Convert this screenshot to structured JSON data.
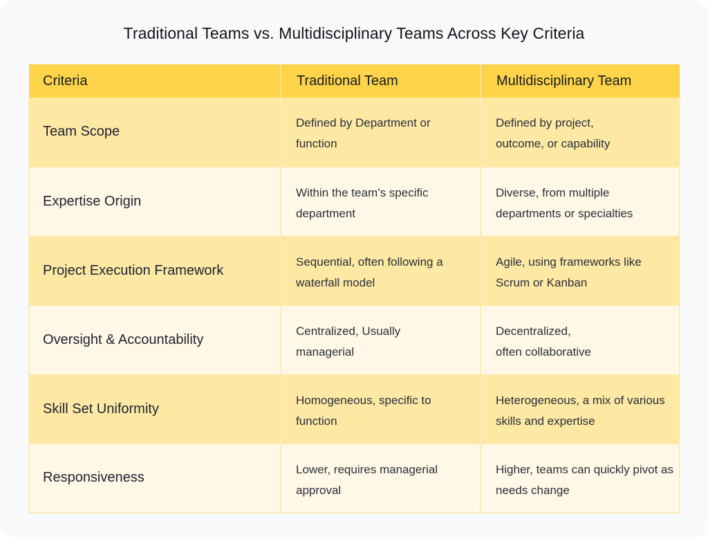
{
  "title": "Traditional Teams vs. Multidisciplinary Teams Across Key Criteria",
  "table": {
    "headers": [
      "Criteria",
      "Traditional Team",
      "Multidisciplinary Team"
    ],
    "rows": [
      {
        "criteria": "Team Scope",
        "traditional": "Defined by Department or function",
        "multidisciplinary": "Defined by project,\noutcome, or capability"
      },
      {
        "criteria": "Expertise Origin",
        "traditional": "Within the team’s specific department",
        "multidisciplinary": "Diverse, from multiple departments or specialties"
      },
      {
        "criteria": "Project Execution Framework",
        "traditional": "Sequential, often following a waterfall model",
        "multidisciplinary": "Agile, using frameworks like Scrum or Kanban"
      },
      {
        "criteria": "Oversight & Accountability",
        "traditional": "Centralized, Usually\nmanagerial",
        "multidisciplinary": "Decentralized,\noften collaborative"
      },
      {
        "criteria": "Skill Set Uniformity",
        "traditional": "Homogeneous, specific to function",
        "multidisciplinary": "Heterogeneous, a mix of various skills and expertise"
      },
      {
        "criteria": "Responsiveness",
        "traditional": "Lower, requires managerial approval",
        "multidisciplinary": "Higher, teams can quickly pivot as needs change"
      }
    ]
  },
  "colors": {
    "header": "#fdd349",
    "row_dark": "#fde8a4",
    "row_light": "#fff8e6",
    "background": "#f8f9fb"
  }
}
